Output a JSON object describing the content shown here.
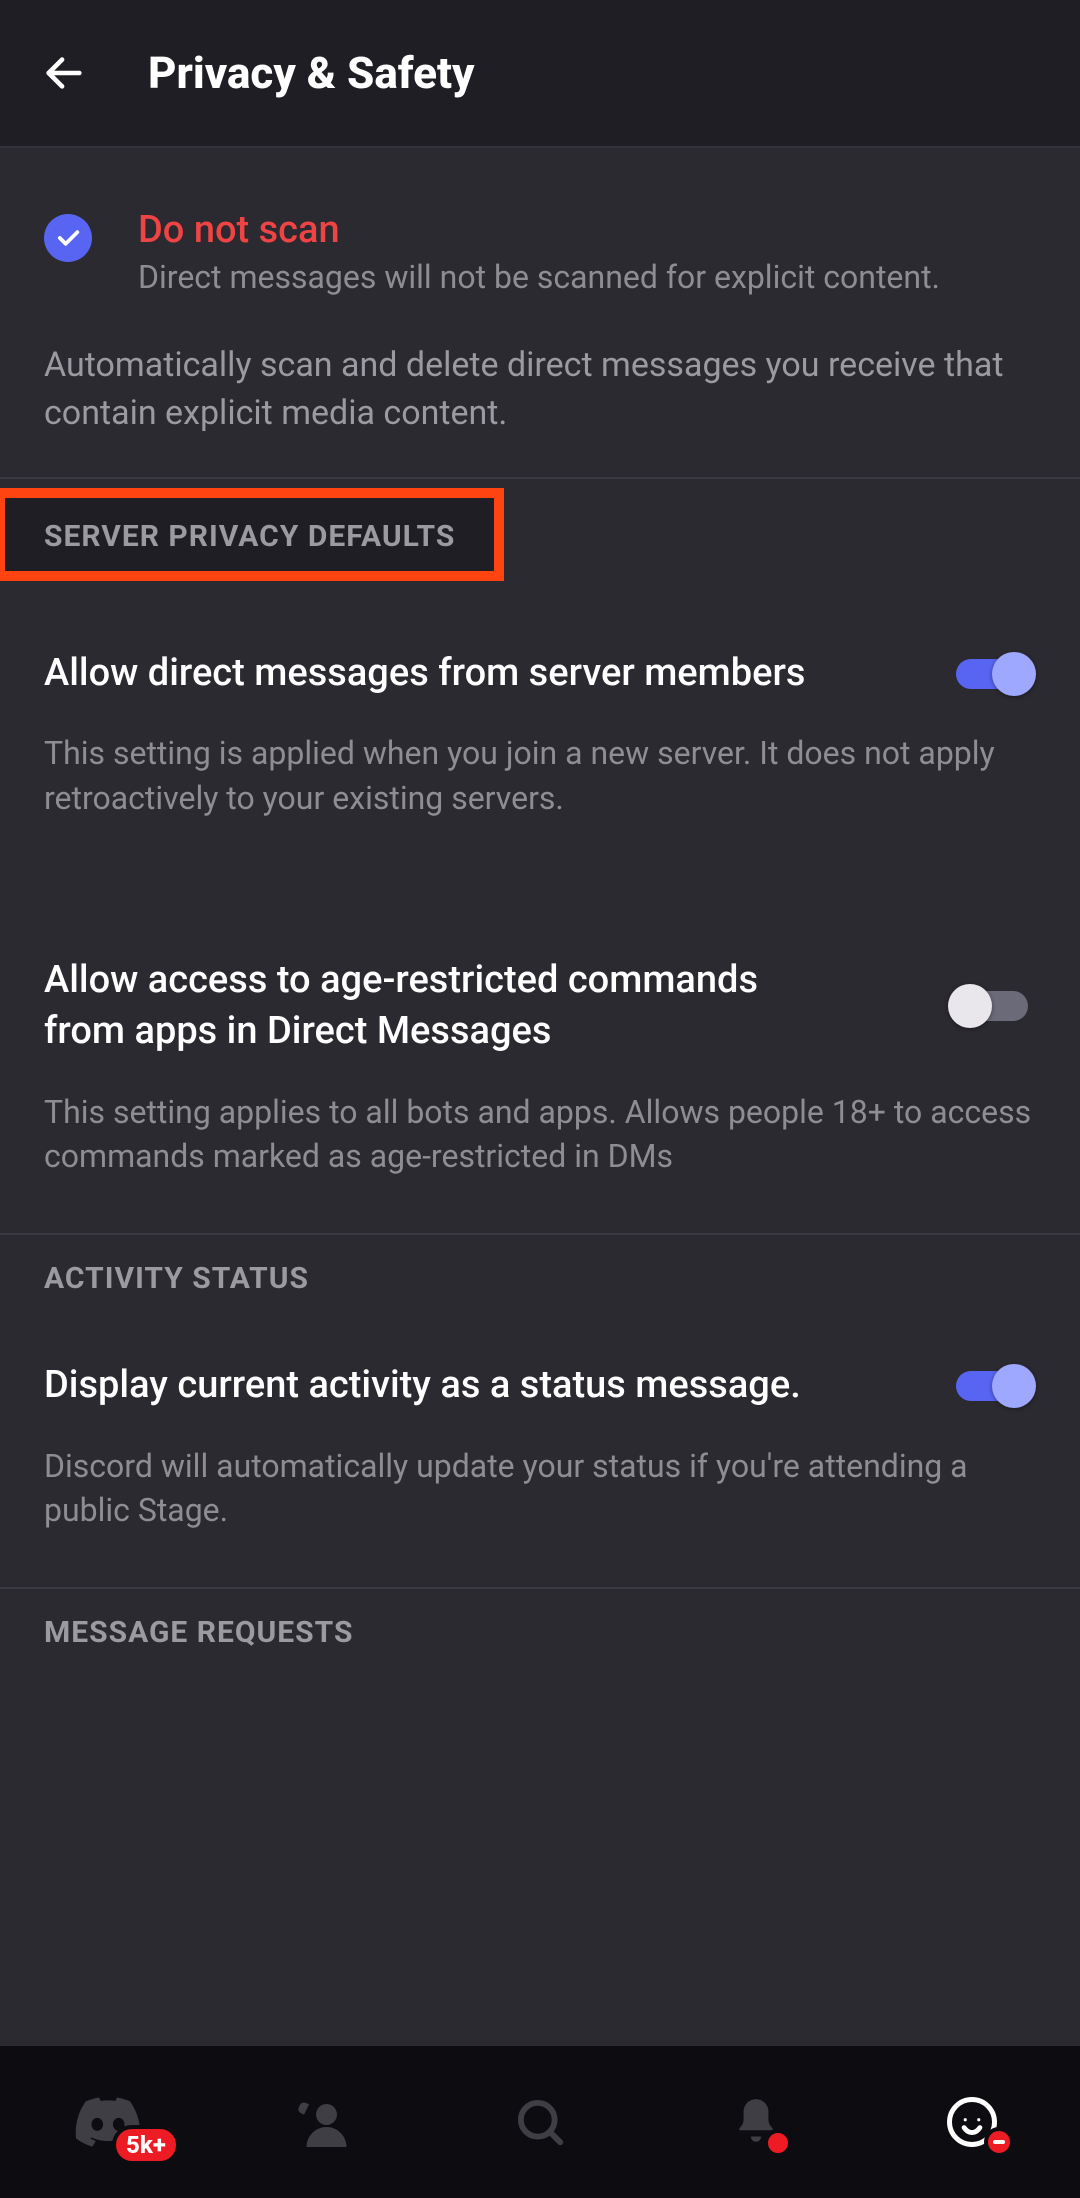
{
  "header": {
    "title": "Privacy & Safety"
  },
  "scan_option": {
    "title": "Do not scan",
    "subtitle": "Direct messages will not be scanned for explicit content.",
    "section_description": "Automatically scan and delete direct messages you receive that contain explicit media content."
  },
  "sections": {
    "server_privacy_defaults": {
      "header": "SERVER PRIVACY DEFAULTS",
      "allow_dm": {
        "title": "Allow direct messages from server members",
        "description": "This setting is applied when you join a new server. It does not apply retroactively to your existing servers.",
        "enabled": true
      },
      "age_restricted": {
        "title": "Allow access to age-restricted commands from apps in Direct Messages",
        "description": "This setting applies to all bots and apps. Allows people 18+ to access commands marked as age-restricted in DMs",
        "enabled": false
      }
    },
    "activity_status": {
      "header": "ACTIVITY STATUS",
      "display_activity": {
        "title": "Display current activity as a status message.",
        "description": "Discord will automatically update your status if you're attending a public Stage.",
        "enabled": true
      }
    },
    "message_requests": {
      "header": "MESSAGE REQUESTS"
    }
  },
  "navbar": {
    "home_badge": "5k+"
  },
  "colors": {
    "accent": "#5865f2",
    "danger_text": "#ef4444",
    "highlight_outline": "#ff4411",
    "badge_bg": "#ed1c24"
  }
}
